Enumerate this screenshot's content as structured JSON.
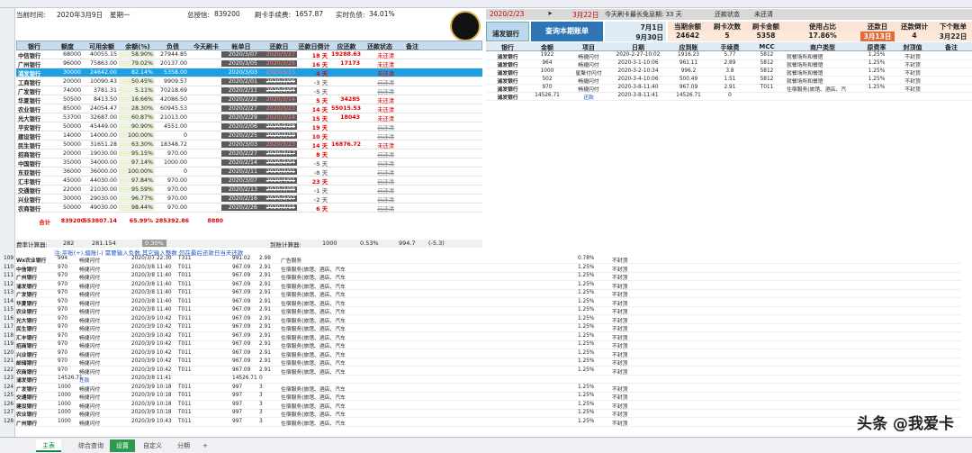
{
  "status": {
    "time_label": "当前时间:",
    "date": "2020年3月9日",
    "weekday": "星期一",
    "total_label": "总授信:",
    "total": "839200",
    "fee_label": "刷卡手续费:",
    "fee": "1657.87",
    "debt_label": "实时负债:",
    "debt": "34.01%"
  },
  "left_headers": [
    "银行",
    "额度",
    "可用余额",
    "余额(%)",
    "负债",
    "今天刷卡",
    "帐单日",
    "还款日",
    "还款日倒计",
    "应还款",
    "还款状态",
    "备注"
  ],
  "banks": [
    {
      "n": "中信银行",
      "q": "68000",
      "a": "40055.15",
      "p": "58.90%",
      "d": "27944.85",
      "bill": "2020/3/07",
      "due": "2020/3/27",
      "cd": "18",
      "pay": "19288.63",
      "st": "未还清"
    },
    {
      "n": "广州银行",
      "q": "96000",
      "a": "75863.00",
      "p": "79.02%",
      "d": "20137.00",
      "bill": "2020/3/05",
      "due": "2020/3/25",
      "cd": "16",
      "pay": "17173",
      "st": "未还清"
    },
    {
      "n": "浦发银行",
      "q": "30000",
      "a": "24642.00",
      "p": "82.14%",
      "d": "5358.00",
      "bill": "2020/3/03",
      "due": "2020/3/13",
      "cd": "4",
      "pay": "",
      "st": "未还清"
    },
    {
      "n": "工商银行",
      "q": "20000",
      "a": "10090.43",
      "p": "50.45%",
      "d": "9909.57",
      "bill": "2020/2/01",
      "due": "2020/3/06",
      "cd": "-3",
      "pay": "",
      "st": "已还清"
    },
    {
      "n": "广发银行",
      "q": "74000",
      "a": "3781.31",
      "p": "5.11%",
      "d": "70218.69",
      "bill": "2020/2/11",
      "due": "2020/3/04",
      "cd": "-5",
      "pay": "",
      "st": "已还清"
    },
    {
      "n": "华夏银行",
      "q": "50500",
      "a": "8413.50",
      "p": "16.66%",
      "d": "42086.50",
      "bill": "2020/2/22",
      "due": "2020/3/14",
      "cd": "5",
      "pay": "34285",
      "st": "未还清"
    },
    {
      "n": "农业银行",
      "q": "85000",
      "a": "24054.47",
      "p": "28.30%",
      "d": "60945.53",
      "bill": "2020/2/27",
      "due": "2020/3/23",
      "cd": "14",
      "pay": "55015.53",
      "st": "未还清"
    },
    {
      "n": "光大银行",
      "q": "53700",
      "a": "32687.00",
      "p": "60.87%",
      "d": "21013.00",
      "bill": "2020/2/29",
      "due": "2020/3/24",
      "cd": "15",
      "pay": "18043",
      "st": "未还清"
    },
    {
      "n": "平安银行",
      "q": "50000",
      "a": "45449.00",
      "p": "90.90%",
      "d": "4551.00",
      "bill": "2020/2/06",
      "due": "2020/3/28",
      "cd": "19",
      "pay": "",
      "st": "已还清"
    },
    {
      "n": "建设银行",
      "q": "14000",
      "a": "14000.00",
      "p": "100.00%",
      "d": "0",
      "bill": "2020/2/25",
      "due": "2020/3/19",
      "cd": "10",
      "pay": "",
      "st": "已还清"
    },
    {
      "n": "民生银行",
      "q": "50000",
      "a": "31651.28",
      "p": "63.30%",
      "d": "18348.72",
      "bill": "2020/3/03",
      "due": "2020/3/23",
      "cd": "14",
      "pay": "16876.72",
      "st": "未还清"
    },
    {
      "n": "招商银行",
      "q": "20000",
      "a": "19030.00",
      "p": "95.15%",
      "d": "970.00",
      "bill": "2020/2/27",
      "due": "2020/3/17",
      "cd": "8",
      "pay": "",
      "st": "已还清"
    },
    {
      "n": "中国银行",
      "q": "35000",
      "a": "34000.00",
      "p": "97.14%",
      "d": "1000.00",
      "bill": "2020/2/14",
      "due": "2020/3/04",
      "cd": "-5",
      "pay": "",
      "st": "已还清"
    },
    {
      "n": "东亚银行",
      "q": "36000",
      "a": "36000.00",
      "p": "100.00%",
      "d": "0",
      "bill": "2020/2/11",
      "due": "2020/3/01",
      "cd": "-8",
      "pay": "",
      "st": "已还清"
    },
    {
      "n": "汇丰银行",
      "q": "45000",
      "a": "44030.00",
      "p": "97.84%",
      "d": "970.00",
      "bill": "2020/3/07",
      "due": "2020/4/01",
      "cd": "23",
      "pay": "",
      "st": "已还清"
    },
    {
      "n": "交通银行",
      "q": "22000",
      "a": "21030.00",
      "p": "95.59%",
      "d": "970.00",
      "bill": "2020/2/13",
      "due": "2020/3/08",
      "cd": "-1",
      "pay": "",
      "st": "已还清"
    },
    {
      "n": "兴业银行",
      "q": "30000",
      "a": "29030.00",
      "p": "96.77%",
      "d": "970.00",
      "bill": "2020/2/16",
      "due": "2020/3/07",
      "cd": "-2",
      "pay": "",
      "st": "已还清"
    },
    {
      "n": "农商银行",
      "q": "50000",
      "a": "49030.00",
      "p": "98.44%",
      "d": "970.00",
      "bill": "2020/2/26",
      "due": "2020/3/15",
      "cd": "6",
      "pay": "",
      "st": "已还清"
    }
  ],
  "total_row": {
    "label": "合计",
    "q": "839200",
    "a": "553807.14",
    "p": "65.99%",
    "d": "285392.86",
    "today": "8880"
  },
  "calc": {
    "label": "费率计算器:",
    "a": "282",
    "b": "281.154",
    "c": "0.30%",
    "label2": "到账计算器:",
    "d": "1000",
    "e": "0.53%",
    "f": "994.7",
    "g": "(-5.3)"
  },
  "note": "注:平账(+),偏账(-)  需要输入负数,其它输入整数      勿在最后还款日当天还款",
  "txn_rows": [
    [
      "109",
      "Wx农业银行",
      "994",
      "畅捷闪付",
      "2020/3/7 22:30",
      "T311",
      "991.02",
      "2.98",
      "广告服务",
      "0.78%",
      "不封顶"
    ],
    [
      "110",
      "中信银行",
      "970",
      "畅捷闪付",
      "2020/3/8 11:40",
      "T011",
      "967.09",
      "2.91",
      "住宿服务(旅馆、酒店、汽车",
      "1.25%",
      "不封顶"
    ],
    [
      "111",
      "广州银行",
      "970",
      "畅捷闪付",
      "2020/3/8 11:40",
      "T011",
      "967.09",
      "2.91",
      "住宿服务(旅馆、酒店、汽车",
      "1.25%",
      "不封顶"
    ],
    [
      "112",
      "浦发银行",
      "970",
      "畅捷闪付",
      "2020/3/8 11:40",
      "T011",
      "967.09",
      "2.91",
      "住宿服务(旅馆、酒店、汽车",
      "1.25%",
      "不封顶"
    ],
    [
      "113",
      "广发银行",
      "970",
      "畅捷闪付",
      "2020/3/8 11:40",
      "T011",
      "967.09",
      "2.91",
      "住宿服务(旅馆、酒店、汽车",
      "1.25%",
      "不封顶"
    ],
    [
      "114",
      "华夏银行",
      "970",
      "畅捷闪付",
      "2020/3/8 11:40",
      "T011",
      "967.09",
      "2.91",
      "住宿服务(旅馆、酒店、汽车",
      "1.25%",
      "不封顶"
    ],
    [
      "115",
      "农业银行",
      "970",
      "畅捷闪付",
      "2020/3/8 11:40",
      "T011",
      "967.09",
      "2.91",
      "住宿服务(旅馆、酒店、汽车",
      "1.25%",
      "不封顶"
    ],
    [
      "116",
      "光大银行",
      "970",
      "畅捷闪付",
      "2020/3/9 10:42",
      "T011",
      "967.09",
      "2.91",
      "住宿服务(旅馆、酒店、汽车",
      "1.25%",
      "不封顶"
    ],
    [
      "117",
      "民生银行",
      "970",
      "畅捷闪付",
      "2020/3/9 10:42",
      "T011",
      "967.09",
      "2.91",
      "住宿服务(旅馆、酒店、汽车",
      "1.25%",
      "不封顶"
    ],
    [
      "118",
      "汇丰银行",
      "970",
      "畅捷闪付",
      "2020/3/9 10:42",
      "T011",
      "967.09",
      "2.91",
      "住宿服务(旅馆、酒店、汽车",
      "1.25%",
      "不封顶"
    ],
    [
      "119",
      "招商银行",
      "970",
      "畅捷闪付",
      "2020/3/9 10:42",
      "T011",
      "967.09",
      "2.91",
      "住宿服务(旅馆、酒店、汽车",
      "1.25%",
      "不封顶"
    ],
    [
      "120",
      "兴业银行",
      "970",
      "畅捷闪付",
      "2020/3/9 10:42",
      "T011",
      "967.09",
      "2.91",
      "住宿服务(旅馆、酒店、汽车",
      "1.25%",
      "不封顶"
    ],
    [
      "121",
      "邮储银行",
      "970",
      "畅捷闪付",
      "2020/3/9 10:42",
      "T011",
      "967.09",
      "2.91",
      "住宿服务(旅馆、酒店、汽车",
      "1.25%",
      "不封顶"
    ],
    [
      "122",
      "农商银行",
      "970",
      "畅捷闪付",
      "2020/3/9 10:42",
      "T011",
      "967.09",
      "2.91",
      "住宿服务(旅馆、酒店、汽车",
      "1.25%",
      "不封顶"
    ],
    [
      "123",
      "浦发银行",
      "14526.71",
      "还款",
      "2020/3/8 11:41",
      "",
      "14526.71",
      "0",
      "",
      "",
      ""
    ],
    [
      "124",
      "广发银行",
      "1000",
      "畅捷闪付",
      "2020/3/9 10:18",
      "T011",
      "997",
      "3",
      "住宿服务(旅馆、酒店、汽车",
      "1.25%",
      "不封顶"
    ],
    [
      "125",
      "交通银行",
      "1000",
      "畅捷闪付",
      "2020/3/9 10:18",
      "T011",
      "997",
      "3",
      "住宿服务(旅馆、酒店、汽车",
      "1.25%",
      "不封顶"
    ],
    [
      "126",
      "建设银行",
      "1000",
      "畅捷闪付",
      "2020/3/9 10:18",
      "T011",
      "997",
      "3",
      "住宿服务(旅馆、酒店、汽车",
      "1.25%",
      "不封顶"
    ],
    [
      "127",
      "农业银行",
      "1000",
      "畅捷闪付",
      "2020/3/9 10:18",
      "T011",
      "997",
      "3",
      "住宿服务(旅馆、酒店、汽车",
      "1.25%",
      "不封顶"
    ],
    [
      "128",
      "广州银行",
      "1000",
      "畅捷闪付",
      "2020/3/9 10:43",
      "T011",
      "997",
      "3",
      "住宿服务(旅馆、酒店、汽车",
      "1.25%",
      "不封顶"
    ]
  ],
  "right": {
    "date": "2020/2/23",
    "arrow": "➤",
    "date2": "3月22日",
    "free_label": "今天刷卡最长免息期: 33 天",
    "state_label": "还款状态",
    "state": "未还清",
    "bank": "浦发银行",
    "query_btn": "查询本期账单",
    "bill_from": "7月1日",
    "bill_to": "9月30日",
    "h1": [
      "当期余额",
      "刷卡次数",
      "刷卡金额",
      "使用占比",
      "还款日",
      "还款倒计",
      "下个账单"
    ],
    "v1": [
      "24642",
      "5",
      "5358",
      "17.86%",
      "3月13日",
      "4",
      "3月22日"
    ],
    "h2": [
      "银行",
      "金额",
      "项目",
      "日期",
      "应到账",
      "手续费",
      "MCC",
      "商户类型",
      "原费率",
      "封顶值",
      "备注"
    ],
    "rows": [
      [
        "浦发银行",
        "1922",
        "畅捷闪付",
        "2020-2-27-10:02",
        "1916.23",
        "5.77",
        "5812",
        "就餐场所和餐馆",
        "1.25%",
        "不封顶"
      ],
      [
        "浦发银行",
        "964",
        "畅捷闪付",
        "2020-3-1-10:06",
        "961.11",
        "2.89",
        "5812",
        "就餐场所和餐馆",
        "1.25%",
        "不封顶"
      ],
      [
        "浦发银行",
        "1000",
        "星聚付闪付",
        "2020-3-2-10:34",
        "996.2",
        "3.8",
        "5812",
        "就餐场所和餐馆",
        "1.25%",
        "不封顶"
      ],
      [
        "浦发银行",
        "502",
        "畅捷闪付",
        "2020-3-4-10:06",
        "500.49",
        "1.51",
        "5812",
        "就餐场所和餐馆",
        "1.25%",
        "不封顶"
      ],
      [
        "浦发银行",
        "970",
        "畅捷闪付",
        "2020-3-8-11:40",
        "967.09",
        "2.91",
        "T011",
        "住宿服务(旅馆、酒店、汽",
        "1.25%",
        "不封顶"
      ],
      [
        "浦发银行",
        "14526.71",
        "还款",
        "2020-3-8-11:41",
        "14526.71",
        "0",
        "",
        "",
        "",
        ""
      ]
    ]
  },
  "tabs": [
    "主表",
    "综合查询",
    "设置",
    "自定义",
    "分期",
    "+"
  ],
  "watermark": "头条 @我爱卡",
  "logo_text": "我爱卡"
}
